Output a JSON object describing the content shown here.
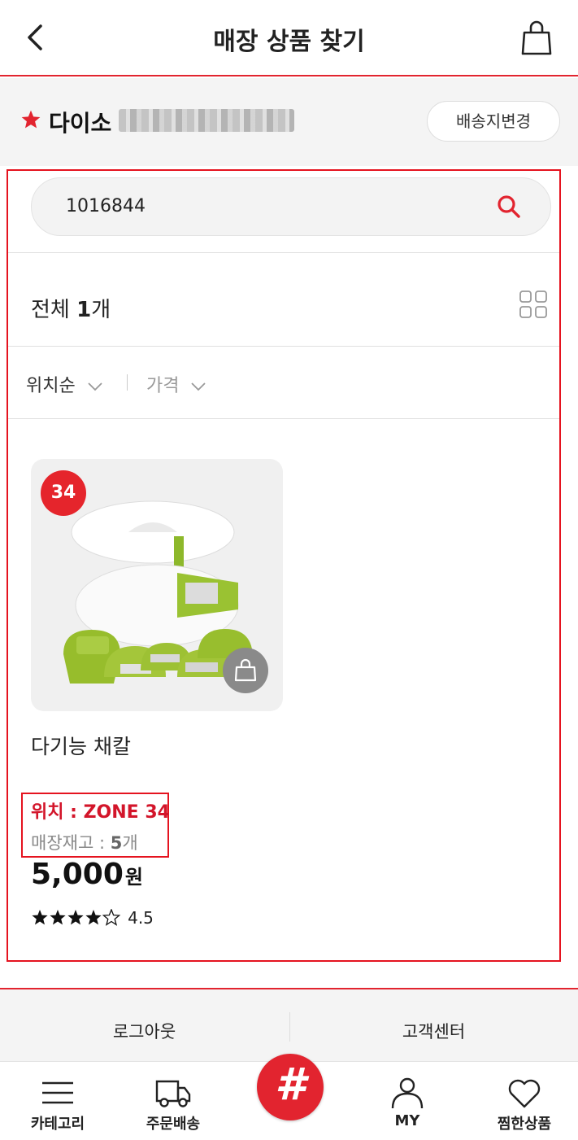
{
  "header": {
    "title": "매장 상품 찾기",
    "back_icon": "chevron-left-icon",
    "cart_icon": "shopping-bag-icon"
  },
  "store": {
    "name": "다이소",
    "change_label": "배송지변경",
    "accent": "#e2242f"
  },
  "search": {
    "value": "1016844"
  },
  "results": {
    "total_label": "전체 ",
    "total_count": "1",
    "total_suffix": "개"
  },
  "sort": {
    "location_label": "위치순",
    "price_label": "가격"
  },
  "product": {
    "zone_badge": "34",
    "name": "다기능 채칼",
    "location": "위치 : ZONE 34",
    "stock_label": "매장재고 : ",
    "stock_count": "5",
    "stock_unit": "개",
    "price": "5,000",
    "price_unit": "원",
    "rating": "4.5",
    "rating_value": 4.5
  },
  "footer": {
    "logout": "로그아웃",
    "customer_center": "고객센터"
  },
  "nav": {
    "category": "카테고리",
    "delivery": "주문배송",
    "my": "MY",
    "wishlist": "찜한상품"
  }
}
